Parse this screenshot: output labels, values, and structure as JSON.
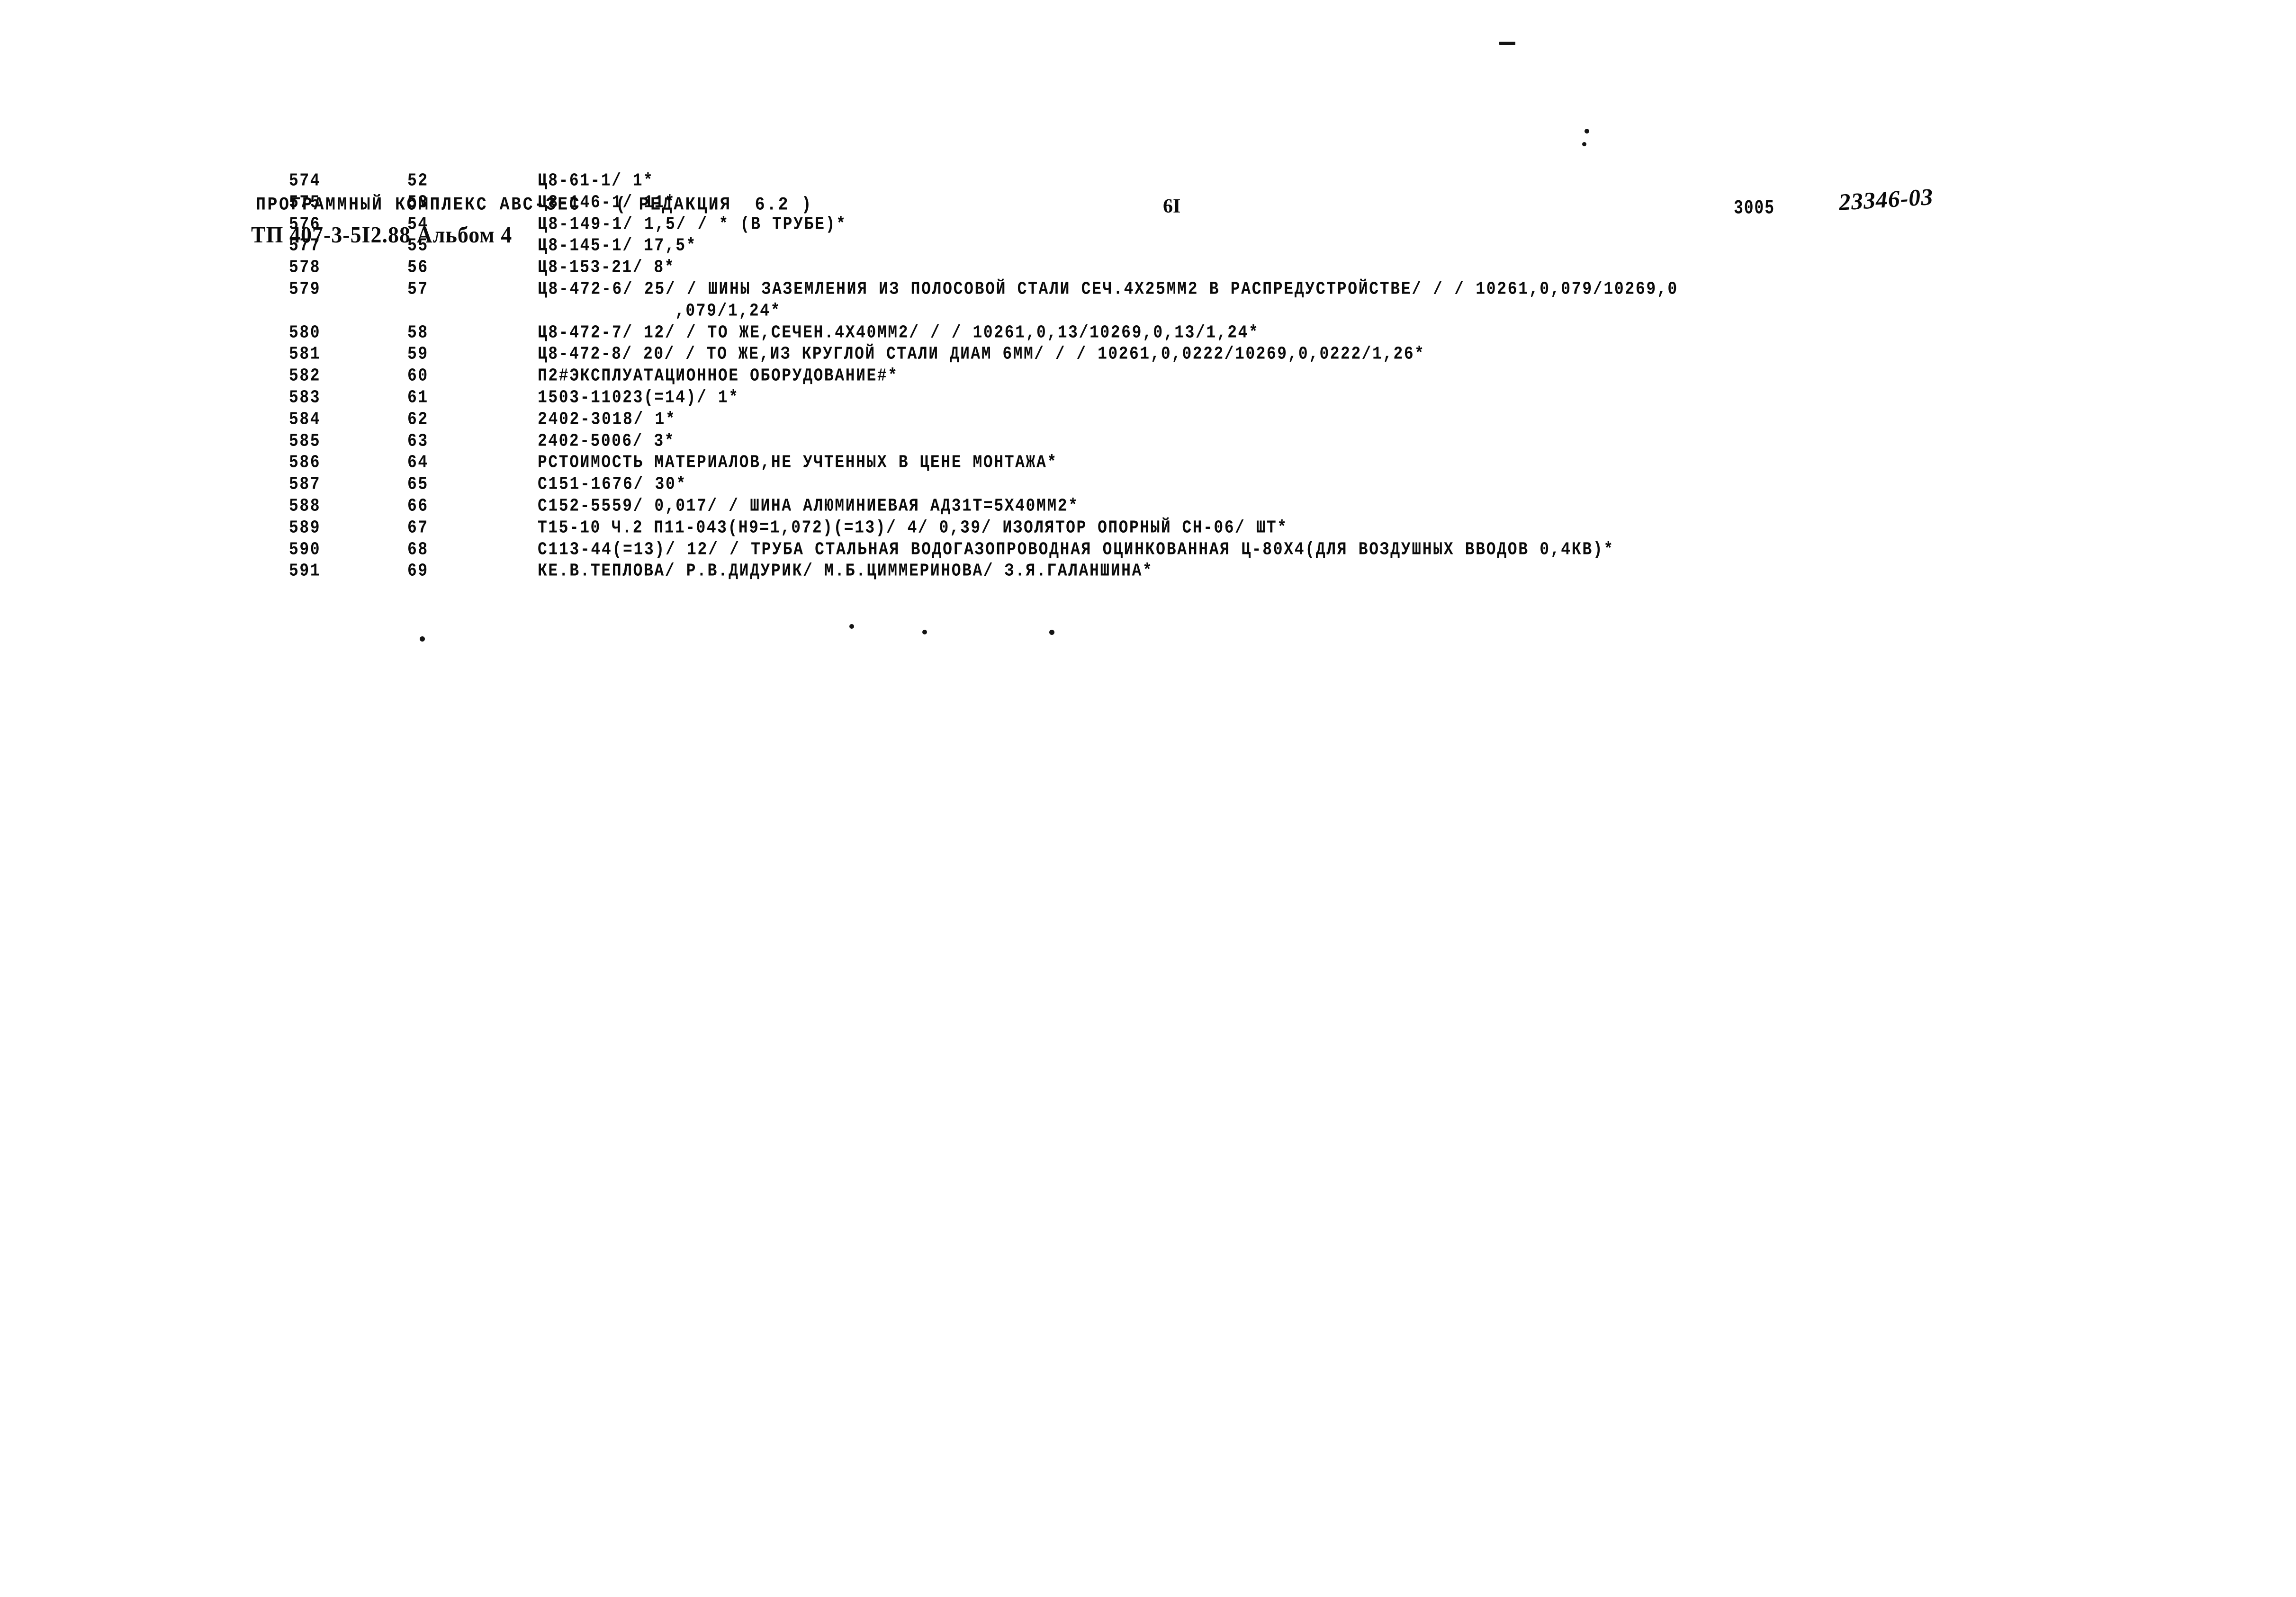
{
  "document": {
    "header": {
      "program_title": "ПРОГРАММНЫЙ КОМПЛЕКС АВС-ЗЕС   ( РЕДАКЦИЯ  6.2 )",
      "doc_code": "ТП 407-3-5I2.88 Альбом 4",
      "page_number": "6I",
      "stamp_number": "3005",
      "archive_number": "23346-03"
    },
    "listing": {
      "columns": [
        "seq",
        "pos",
        "body"
      ],
      "rows": [
        {
          "seq": "574",
          "pos": "52",
          "body": "Ц8-61-1/ 1*",
          "continuation": ""
        },
        {
          "seq": "575",
          "pos": "53",
          "body": "Ц8-146-1/ 11*",
          "continuation": ""
        },
        {
          "seq": "576",
          "pos": "54",
          "body": "Ц8-149-1/ 1,5/ / * (В ТРУБЕ)*",
          "continuation": ""
        },
        {
          "seq": "577",
          "pos": "55",
          "body": "Ц8-145-1/ 17,5*",
          "continuation": ""
        },
        {
          "seq": "578",
          "pos": "56",
          "body": "Ц8-153-21/ 8*",
          "continuation": ""
        },
        {
          "seq": "579",
          "pos": "57",
          "body": "Ц8-472-6/ 25/ / ШИНЫ ЗАЗЕМЛЕНИЯ ИЗ ПОЛОСОВОЙ СТАЛИ СЕЧ.4Х25ММ2 В РАСПРЕДУСТРОЙСТВЕ/ / / 10261,0,079/10269,0",
          "continuation": ",079/1,24*"
        },
        {
          "seq": "580",
          "pos": "58",
          "body": "Ц8-472-7/ 12/ / ТО ЖЕ,СЕЧЕН.4Х40ММ2/ / / 10261,0,13/10269,0,13/1,24*",
          "continuation": ""
        },
        {
          "seq": "581",
          "pos": "59",
          "body": "Ц8-472-8/ 20/ / ТО ЖЕ,ИЗ КРУГЛОЙ СТАЛИ ДИАМ 6ММ/ / / 10261,0,0222/10269,0,0222/1,26*",
          "continuation": ""
        },
        {
          "seq": "582",
          "pos": "60",
          "body": "П2#ЭКСПЛУАТАЦИОННОЕ ОБОРУДОВАНИЕ#*",
          "continuation": ""
        },
        {
          "seq": "583",
          "pos": "61",
          "body": "1503-11023(=14)/ 1*",
          "continuation": ""
        },
        {
          "seq": "584",
          "pos": "62",
          "body": "2402-3018/ 1*",
          "continuation": ""
        },
        {
          "seq": "585",
          "pos": "63",
          "body": "2402-5006/ 3*",
          "continuation": ""
        },
        {
          "seq": "586",
          "pos": "64",
          "body": "РСТОИМОСТЬ МАТЕРИАЛОВ,НЕ УЧТЕННЫХ В ЦЕНЕ МОНТАЖА*",
          "continuation": ""
        },
        {
          "seq": "587",
          "pos": "65",
          "body": "С151-1676/ 30*",
          "continuation": ""
        },
        {
          "seq": "588",
          "pos": "66",
          "body": "С152-5559/ 0,017/ / ШИНА АЛЮМИНИЕВАЯ АД31Т=5Х40ММ2*",
          "continuation": ""
        },
        {
          "seq": "589",
          "pos": "67",
          "body": "Т15-10 Ч.2 П11-043(Н9=1,072)(=13)/ 4/ 0,39/ ИЗОЛЯТОР ОПОРНЫЙ СН-06/ ШТ*",
          "continuation": ""
        },
        {
          "seq": "590",
          "pos": "68",
          "body": "С113-44(=13)/ 12/ / ТРУБА СТАЛЬНАЯ ВОДОГАЗОПРОВОДНАЯ ОЦИНКОВАННАЯ Ц-80Х4(ДЛЯ ВОЗДУШНЫХ ВВОДОВ 0,4КВ)*",
          "continuation": ""
        },
        {
          "seq": "591",
          "pos": "69",
          "body": "КЕ.В.ТЕПЛОВА/ Р.В.ДИДУРИК/ М.Б.ЦИММЕРИНОВА/ З.Я.ГАЛАНШИНА*",
          "continuation": ""
        }
      ]
    },
    "colors": {
      "ink": "#0a0a0a",
      "paper": "#ffffff"
    }
  }
}
